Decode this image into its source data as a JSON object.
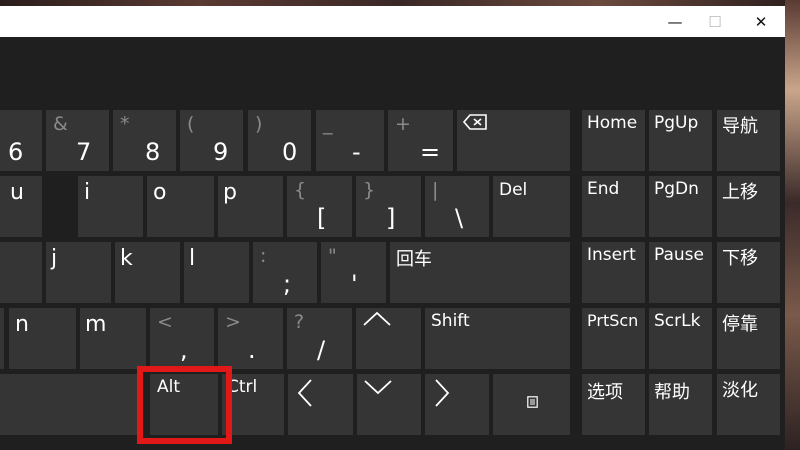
{
  "window": {
    "minimize_glyph": "—",
    "maximize_glyph": "☐",
    "close_glyph": "✕"
  },
  "keys": {
    "k6": "6",
    "k7_shift": "&",
    "k7": "7",
    "k8_shift": "*",
    "k8": "8",
    "k9_shift": "(",
    "k9": "9",
    "k0_shift": ")",
    "k0": "0",
    "minus_shift": "_",
    "minus": "-",
    "equals_shift": "+",
    "equals": "=",
    "u": "u",
    "i": "i",
    "o": "o",
    "p": "p",
    "lbracket_shift": "{",
    "lbracket": "[",
    "rbracket_shift": "}",
    "rbracket": "]",
    "backslash_shift": "|",
    "backslash": "\\",
    "del": "Del",
    "j": "j",
    "k": "k",
    "l": "l",
    "semicolon_shift": ":",
    "semicolon": ";",
    "quote_shift": "\"",
    "quote": "'",
    "enter": "回车",
    "n": "n",
    "m": "m",
    "comma_shift": "<",
    "comma": ",",
    "period_shift": ">",
    "period": ".",
    "slash_shift": "?",
    "slash": "/",
    "shift": "Shift",
    "alt": "Alt",
    "ctrl": "Ctrl",
    "home": "Home",
    "pgup": "PgUp",
    "nav": "导航",
    "end": "End",
    "pgdn": "PgDn",
    "moveup": "上移",
    "insert": "Insert",
    "pause": "Pause",
    "movedown": "下移",
    "prtscn": "PrtScn",
    "scrlk": "ScrLk",
    "dock": "停靠",
    "options": "选项",
    "help": "帮助",
    "fade": "淡化"
  }
}
